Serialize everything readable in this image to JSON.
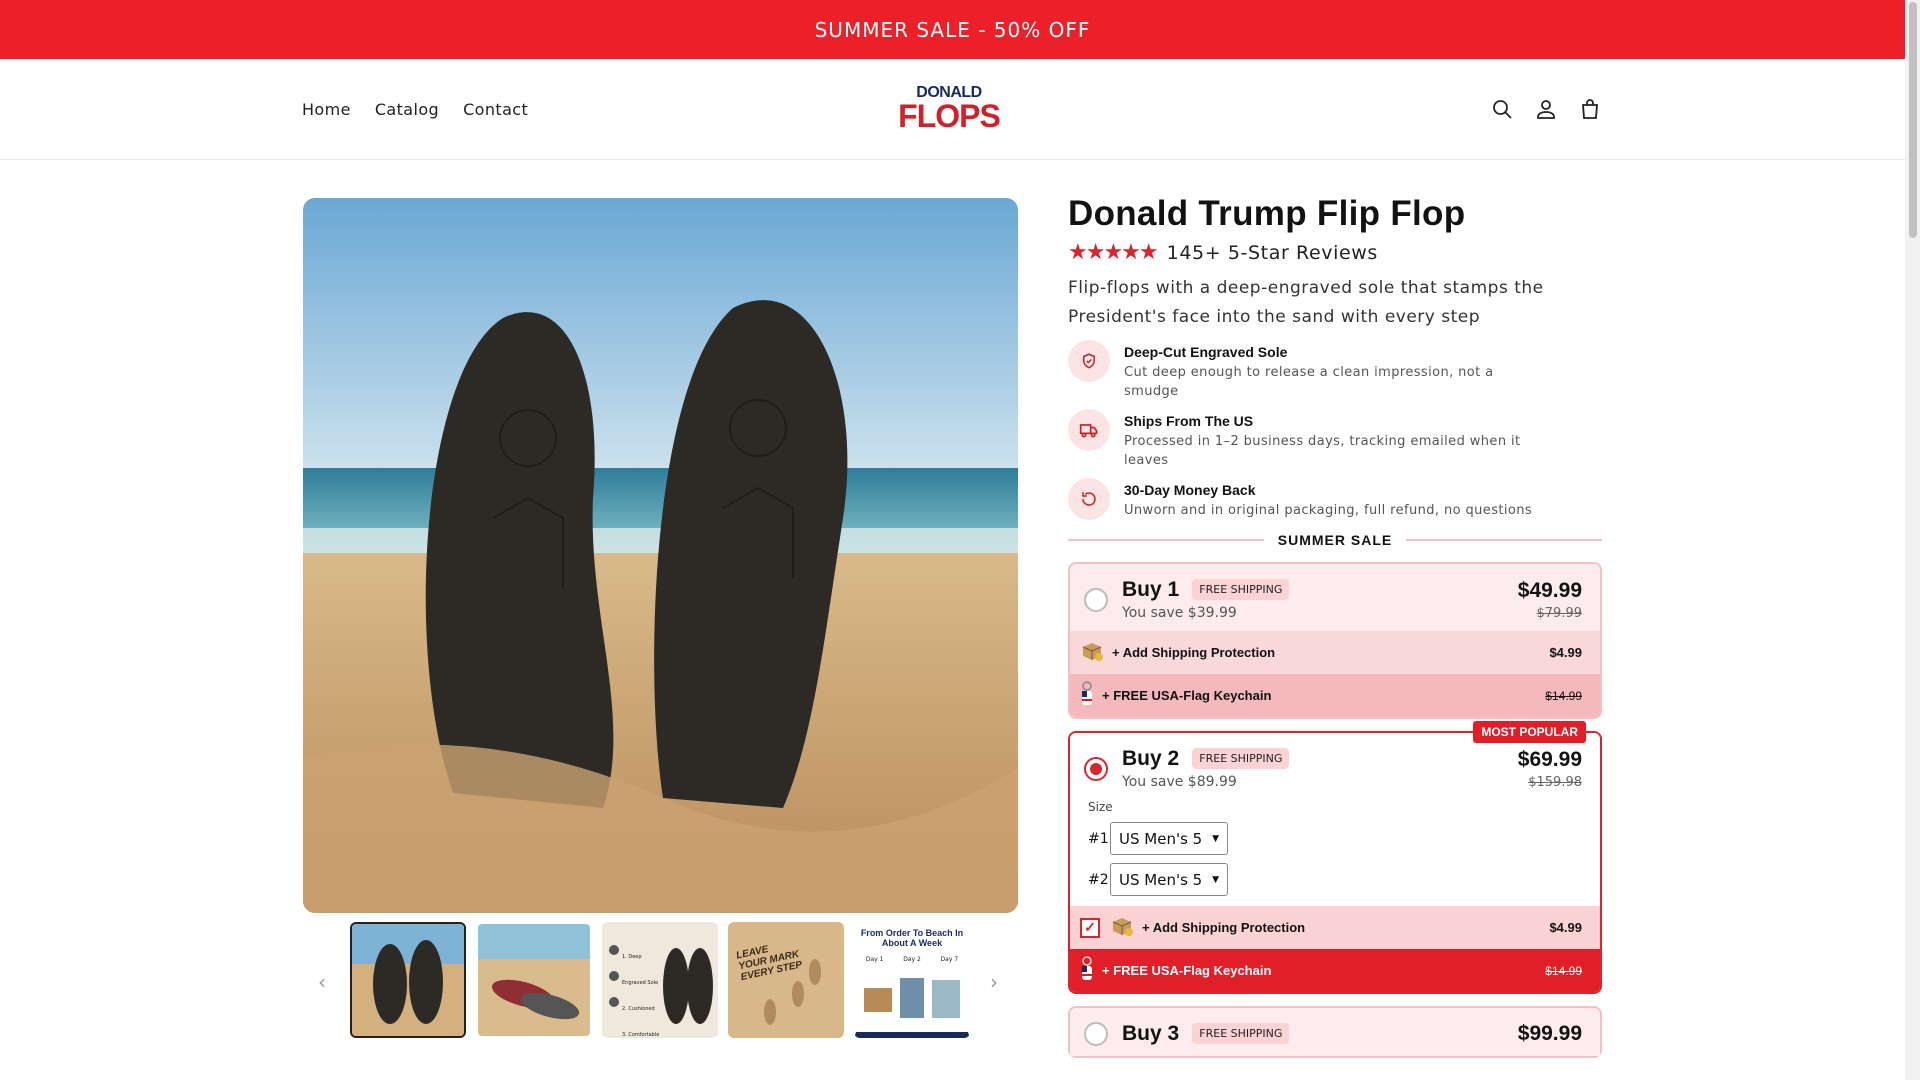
{
  "announcement": "SUMMER SALE - 50% OFF",
  "nav": {
    "home": "Home",
    "catalog": "Catalog",
    "contact": "Contact"
  },
  "logo": {
    "line1": "DONALD",
    "line2": "FLOPS"
  },
  "product": {
    "title": "Donald Trump Flip Flop",
    "stars": "★★★★★",
    "reviews": "145+ 5-Star Reviews",
    "description": "Flip-flops with a deep-engraved sole that stamps the President's face into the sand with every step"
  },
  "features": [
    {
      "title": "Deep-Cut Engraved Sole",
      "sub": "Cut deep enough to release a clean impression, not a smudge",
      "icon": "shield-icon"
    },
    {
      "title": "Ships From The US",
      "sub": "Processed in 1–2 business days, tracking emailed when it leaves",
      "icon": "truck-icon"
    },
    {
      "title": "30-Day Money Back",
      "sub": "Unworn and in original packaging, full refund, no questions",
      "icon": "refresh-icon"
    }
  ],
  "sale_label": "SUMMER SALE",
  "thumbnails": {
    "t3_lines": [
      "1. Deep Engraved Sole",
      "2. Cushioned",
      "3. Comfortable"
    ],
    "t4_text": [
      "LEAVE",
      "YOUR MARK",
      "EVERY STEP"
    ],
    "t5_title": "From Order To Beach In About A Week",
    "t5_days": [
      "Day 1",
      "Day 2",
      "Day 7"
    ]
  },
  "bundles": [
    {
      "title": "Buy 1",
      "badge": "FREE SHIPPING",
      "save": "You save $39.99",
      "price": "$49.99",
      "was": "$79.99",
      "protection": {
        "label": "+ Add Shipping Protection",
        "price": "$4.99"
      },
      "keychain": {
        "label": "+ FREE USA-Flag Keychain",
        "price": "$14.99"
      }
    },
    {
      "title": "Buy 2",
      "badge": "FREE SHIPPING",
      "save": "You save $89.99",
      "price": "$69.99",
      "was": "$159.98",
      "popular": "MOST POPULAR",
      "size_label": "Size",
      "sizes": [
        {
          "n": "#1",
          "value": "US Men's 5"
        },
        {
          "n": "#2",
          "value": "US Men's 5"
        }
      ],
      "protection": {
        "label": "+ Add Shipping Protection",
        "price": "$4.99"
      },
      "keychain": {
        "label": "+ FREE USA-Flag Keychain",
        "price": "$14.99"
      }
    },
    {
      "title": "Buy 3",
      "badge": "FREE SHIPPING",
      "price": "$99.99"
    }
  ],
  "colors": {
    "brand_red": "#ec2028",
    "navy": "#1b2a5e"
  }
}
